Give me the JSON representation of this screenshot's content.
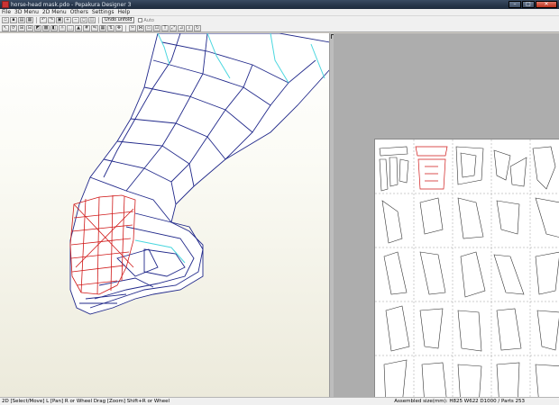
{
  "window": {
    "title": "horse-head mask.pdo - Pepakura Designer 3"
  },
  "menu": [
    "File",
    "3D Menu",
    "2D Menu",
    "Others",
    "Settings",
    "Help"
  ],
  "toolbar": {
    "unfold_button": "Undo unfold",
    "auto_checkbox": "Auto"
  },
  "statusbar": {
    "left": "2D [Select/Move] L [Pan] R or Wheel Drag [Zoom] Shift+R or Wheel",
    "right": "Assembled size(mm): H825 W622 D1000 / Parts 253"
  },
  "colors": {
    "mesh_line": "#20288a",
    "mesh_cut": "#4bd7df",
    "mouth_mesh": "#d01818",
    "viewport_top": "#ffffff",
    "viewport_bottom": "#eceadb",
    "unfold_bg": "#adadad"
  }
}
